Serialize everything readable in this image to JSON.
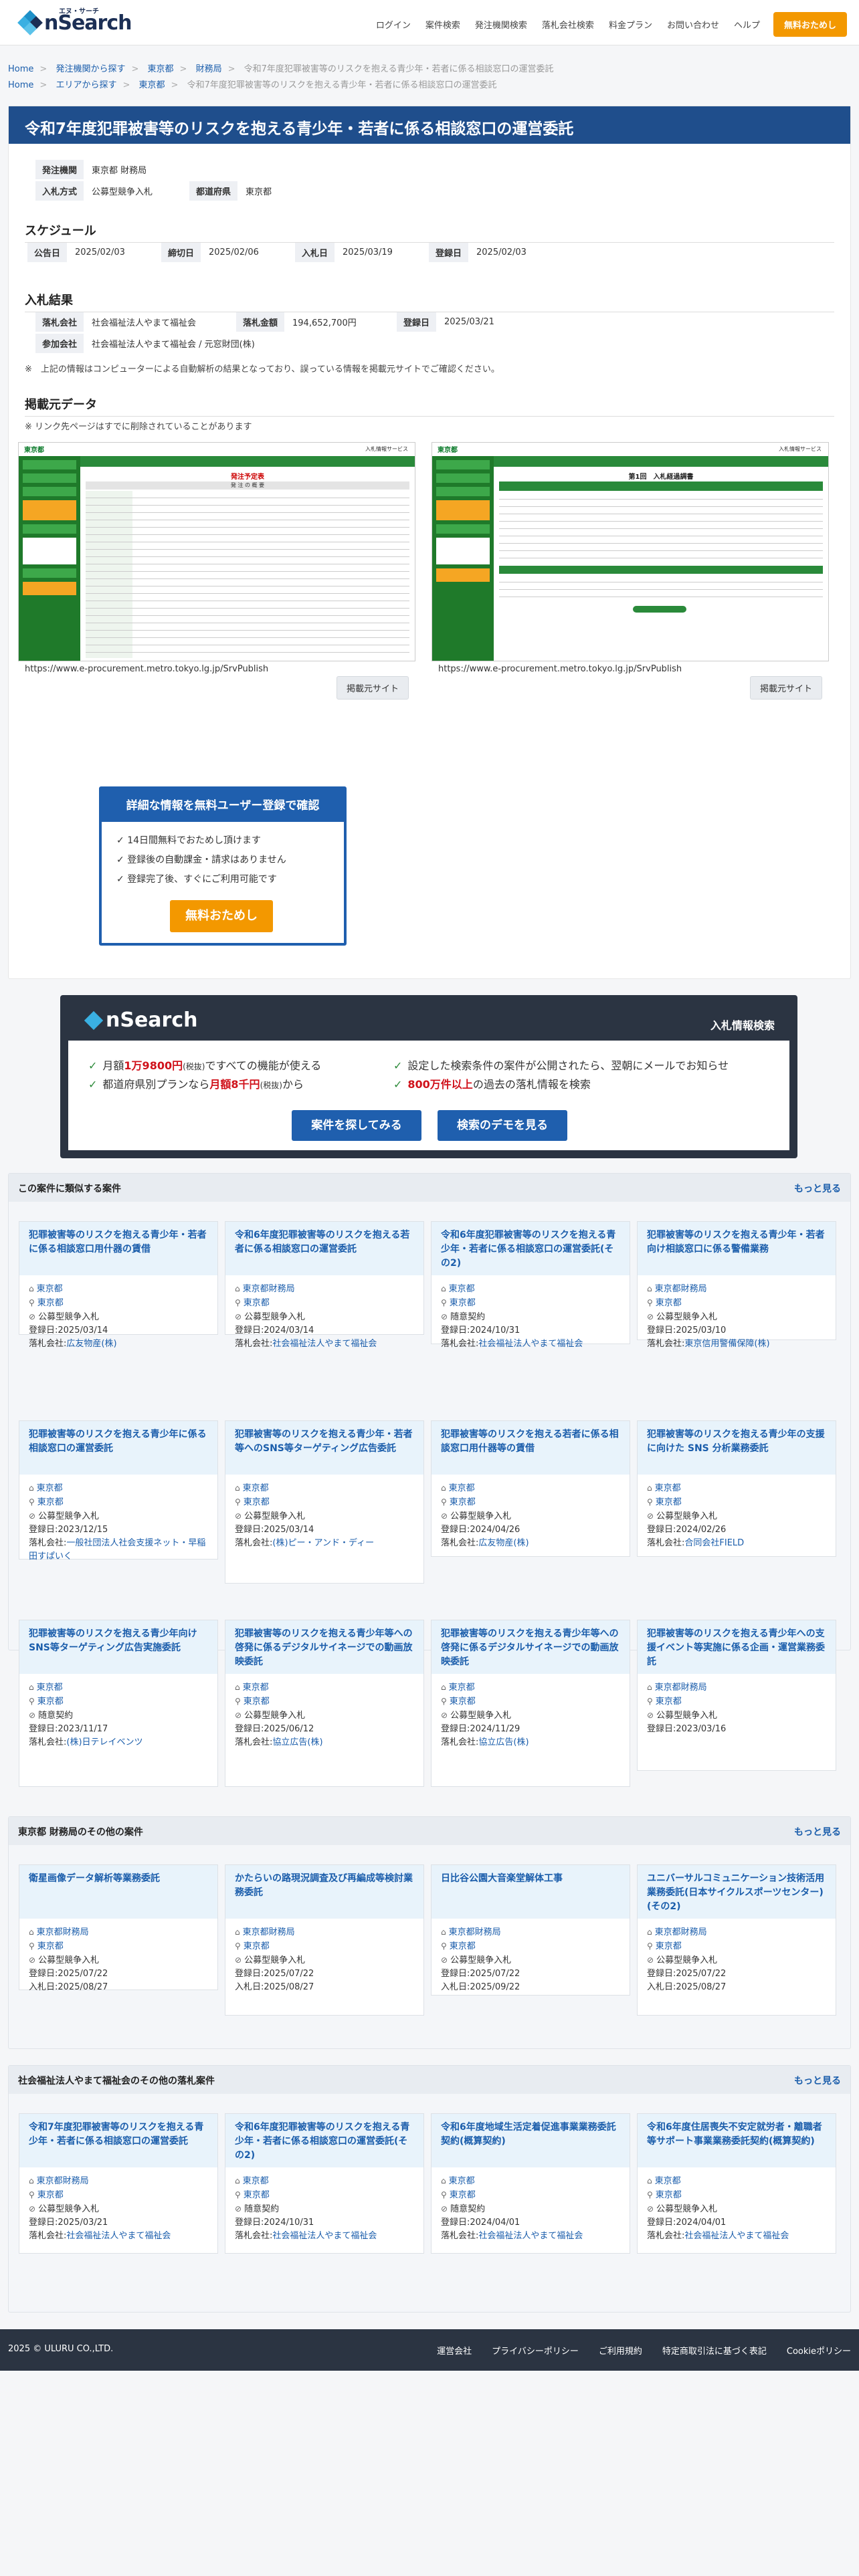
{
  "header": {
    "logo_text": "nSearch",
    "logo_ruby": "エヌ・サーチ",
    "nav": [
      "ログイン",
      "案件検索",
      "発注機関検索",
      "落札会社検索",
      "料金プラン",
      "お問い合わせ",
      "ヘルプ"
    ],
    "cta": "無料おためし"
  },
  "breadcrumb1": [
    "Home",
    "発注機関から探す",
    "東京都",
    "財務局",
    "令和7年度犯罪被害等のリスクを抱える青少年・若者に係る相談窓口の運営委託"
  ],
  "breadcrumb2": [
    "Home",
    "エリアから探す",
    "東京都",
    "令和7年度犯罪被害等のリスクを抱える青少年・若者に係る相談窓口の運営委託"
  ],
  "page_title": "令和7年度犯罪被害等のリスクを抱える青少年・若者に係る相談窓口の運営委託",
  "info": {
    "agency_label": "発注機関",
    "agency": "東京都 財務局",
    "method_label": "入札方式",
    "method": "公募型競争入札",
    "pref_label": "都道府県",
    "pref": "東京都"
  },
  "schedule": {
    "heading": "スケジュール",
    "items": [
      {
        "label": "公告日",
        "value": "2025/02/03"
      },
      {
        "label": "締切日",
        "value": "2025/02/06"
      },
      {
        "label": "入札日",
        "value": "2025/03/19"
      },
      {
        "label": "登録日",
        "value": "2025/02/03"
      }
    ]
  },
  "result": {
    "heading": "入札結果",
    "winner_label": "落札会社",
    "winner": "社会福祉法人やまて福祉会",
    "amount_label": "落札金額",
    "amount": "194,652,700円",
    "reg_label": "登録日",
    "reg": "2025/03/21",
    "participants_label": "参加会社",
    "participants": "社会福祉法人やまて福祉会 / 元窓財団(株)",
    "note": "※　上記の情報はコンピューターによる自動解析の結果となっており、誤っている情報を掲載元サイトでご確認ください。"
  },
  "source": {
    "heading": "掲載元データ",
    "note": "※ リンク先ページはすでに削除されていることがあります",
    "left": {
      "brand": "東京都",
      "service": "入札情報サービス",
      "doc_title": "発注予定表",
      "doc_subtitle": "発 注 の 概 要",
      "url": "https://www.e-procurement.metro.tokyo.lg.jp/SrvPublish",
      "button": "掲載元サイト"
    },
    "right": {
      "brand": "東京都",
      "service": "入札情報サービス",
      "doc_title": "第1回　入札経過調書",
      "url": "https://www.e-procurement.metro.tokyo.lg.jp/SrvPublish",
      "button": "掲載元サイト"
    }
  },
  "register_box": {
    "title": "詳細な情報を無料ユーザー登録で確認",
    "items": [
      "14日間無料でおためし頂けます",
      "登録後の自動課金・請求はありません",
      "登録完了後、すぐにご利用可能です"
    ],
    "button": "無料おためし"
  },
  "promo": {
    "logo": "nSearch",
    "title": "入札情報検索",
    "f1_pre": "月額",
    "f1_red": "1万9800円",
    "f1_small": "(税抜)",
    "f1_post": "ですべての機能が使える",
    "f2_pre": "都道府県別プランなら",
    "f2_red": "月額8千円",
    "f2_small": "(税抜)",
    "f2_post": "から",
    "f3": "設定した検索条件の案件が公開されたら、翌朝にメールでお知らせ",
    "f4_red": "800万件以上",
    "f4_post": "の過去の落札情報を検索",
    "btn1": "案件を探してみる",
    "btn2": "検索のデモを見る"
  },
  "similar": {
    "heading": "この案件に類似する案件",
    "more": "もっと見る",
    "cards": [
      {
        "title": "犯罪被害等のリスクを抱える青少年・若者に係る相談窓口用什器の賃借",
        "agency": "東京都",
        "pref": "東京都",
        "method": "公募型競争入札",
        "date_label": "登録日:",
        "date": "2025/03/14",
        "win_label": "落札会社:",
        "win": "広友物産(株)"
      },
      {
        "title": "令和6年度犯罪被害等のリスクを抱える若者に係る相談窓口の運営委託",
        "agency": "東京都財務局",
        "pref": "東京都",
        "method": "公募型競争入札",
        "date_label": "登録日:",
        "date": "2024/03/14",
        "win_label": "落札会社:",
        "win": "社会福祉法人やまて福祉会"
      },
      {
        "title": "令和6年度犯罪被害等のリスクを抱える青少年・若者に係る相談窓口の運営委託(その2)",
        "agency": "東京都",
        "pref": "東京都",
        "method": "随意契約",
        "date_label": "登録日:",
        "date": "2024/10/31",
        "win_label": "落札会社:",
        "win": "社会福祉法人やまて福祉会"
      },
      {
        "title": "犯罪被害等のリスクを抱える青少年・若者向け相談窓口に係る警備業務",
        "agency": "東京都財務局",
        "pref": "東京都",
        "method": "公募型競争入札",
        "date_label": "登録日:",
        "date": "2025/03/10",
        "win_label": "落札会社:",
        "win": "東京信用警備保障(株)"
      },
      {
        "title": "犯罪被害等のリスクを抱える青少年に係る相談窓口の運営委託",
        "agency": "東京都",
        "pref": "東京都",
        "method": "公募型競争入札",
        "date_label": "登録日:",
        "date": "2023/12/15",
        "win_label": "落札会社:",
        "win": "一般社団法人社会支援ネット・早稲田すぱいく"
      },
      {
        "title": "犯罪被害等のリスクを抱える青少年・若者等へのSNS等ターゲティング広告委託",
        "agency": "東京都",
        "pref": "東京都",
        "method": "公募型競争入札",
        "date_label": "登録日:",
        "date": "2025/03/14",
        "win_label": "落札会社:",
        "win": "(株)ピー・アンド・ディー"
      },
      {
        "title": "犯罪被害等のリスクを抱える若者に係る相談窓口用什器等の賃借",
        "agency": "東京都",
        "pref": "東京都",
        "method": "公募型競争入札",
        "date_label": "登録日:",
        "date": "2024/04/26",
        "win_label": "落札会社:",
        "win": "広友物産(株)"
      },
      {
        "title": "犯罪被害等のリスクを抱える青少年の支援に向けた SNS 分析業務委託",
        "agency": "東京都",
        "pref": "東京都",
        "method": "公募型競争入札",
        "date_label": "登録日:",
        "date": "2024/02/26",
        "win_label": "落札会社:",
        "win": "合同会社FIELD"
      },
      {
        "title": "犯罪被害等のリスクを抱える青少年向けSNS等ターゲティング広告実施委託",
        "agency": "東京都",
        "pref": "東京都",
        "method": "随意契約",
        "date_label": "登録日:",
        "date": "2023/11/17",
        "win_label": "落札会社:",
        "win": "(株)日テレイベンツ"
      },
      {
        "title": "犯罪被害等のリスクを抱える青少年等への啓発に係るデジタルサイネージでの動画放映委託",
        "agency": "東京都",
        "pref": "東京都",
        "method": "公募型競争入札",
        "date_label": "登録日:",
        "date": "2025/06/12",
        "win_label": "落札会社:",
        "win": "協立広告(株)"
      },
      {
        "title": "犯罪被害等のリスクを抱える青少年等への啓発に係るデジタルサイネージでの動画放映委託",
        "agency": "東京都",
        "pref": "東京都",
        "method": "公募型競争入札",
        "date_label": "登録日:",
        "date": "2024/11/29",
        "win_label": "落札会社:",
        "win": "協立広告(株)"
      },
      {
        "title": "犯罪被害等のリスクを抱える青少年への支援イベント等実施に係る企画・運営業務委託",
        "agency": "東京都財務局",
        "pref": "東京都",
        "method": "公募型競争入札",
        "date_label": "登録日:",
        "date": "2023/03/16",
        "win_label": "",
        "win": ""
      }
    ]
  },
  "agency_other": {
    "heading": "東京都 財務局のその他の案件",
    "more": "もっと見る",
    "cards": [
      {
        "title": "衛星画像データ解析等業務委託",
        "agency": "東京都財務局",
        "pref": "東京都",
        "method": "公募型競争入札",
        "date_label": "登録日:",
        "date": "2025/07/22",
        "bid_label": "入札日:",
        "bid": "2025/08/27"
      },
      {
        "title": "かたらいの路現況調査及び再編成等検討業務委託",
        "agency": "東京都財務局",
        "pref": "東京都",
        "method": "公募型競争入札",
        "date_label": "登録日:",
        "date": "2025/07/22",
        "bid_label": "入札日:",
        "bid": "2025/08/27"
      },
      {
        "title": "日比谷公園大音楽堂解体工事",
        "agency": "東京都財務局",
        "pref": "東京都",
        "method": "公募型競争入札",
        "date_label": "登録日:",
        "date": "2025/07/22",
        "bid_label": "入札日:",
        "bid": "2025/09/22"
      },
      {
        "title": "ユニバーサルコミュニケーション技術活用業務委託(日本サイクルスポーツセンター)(その2)",
        "agency": "東京都財務局",
        "pref": "東京都",
        "method": "公募型競争入札",
        "date_label": "登録日:",
        "date": "2025/07/22",
        "bid_label": "入札日:",
        "bid": "2025/08/27"
      }
    ]
  },
  "winner_other": {
    "heading": "社会福祉法人やまて福祉会のその他の落札案件",
    "more": "もっと見る",
    "cards": [
      {
        "title": "令和7年度犯罪被害等のリスクを抱える青少年・若者に係る相談窓口の運営委託",
        "agency": "東京都財務局",
        "pref": "東京都",
        "method": "公募型競争入札",
        "date_label": "登録日:",
        "date": "2025/03/21",
        "win_label": "落札会社:",
        "win": "社会福祉法人やまて福祉会"
      },
      {
        "title": "令和6年度犯罪被害等のリスクを抱える青少年・若者に係る相談窓口の運営委託(その2)",
        "agency": "東京都",
        "pref": "東京都",
        "method": "随意契約",
        "date_label": "登録日:",
        "date": "2024/10/31",
        "win_label": "落札会社:",
        "win": "社会福祉法人やまて福祉会"
      },
      {
        "title": "令和6年度地域生活定着促進事業業務委託契約(概算契約)",
        "agency": "東京都",
        "pref": "東京都",
        "method": "随意契約",
        "date_label": "登録日:",
        "date": "2024/04/01",
        "win_label": "落札会社:",
        "win": "社会福祉法人やまて福祉会"
      },
      {
        "title": "令和6年度住居喪失不安定就労者・離職者等サポート事業業務委託契約(概算契約)",
        "agency": "東京都",
        "pref": "東京都",
        "method": "公募型競争入札",
        "date_label": "登録日:",
        "date": "2024/04/01",
        "win_label": "落札会社:",
        "win": "社会福祉法人やまて福祉会"
      }
    ]
  },
  "footer": {
    "copyright": "2025 © ULURU CO.,LTD.",
    "links": [
      "運営会社",
      "プライバシーポリシー",
      "ご利用規約",
      "特定商取引法に基づく表記",
      "Cookieポリシー"
    ]
  },
  "colors": {
    "primary": "#1f4e8c",
    "accent": "#f39800",
    "dark": "#2b3442",
    "link": "#1a5dab"
  }
}
